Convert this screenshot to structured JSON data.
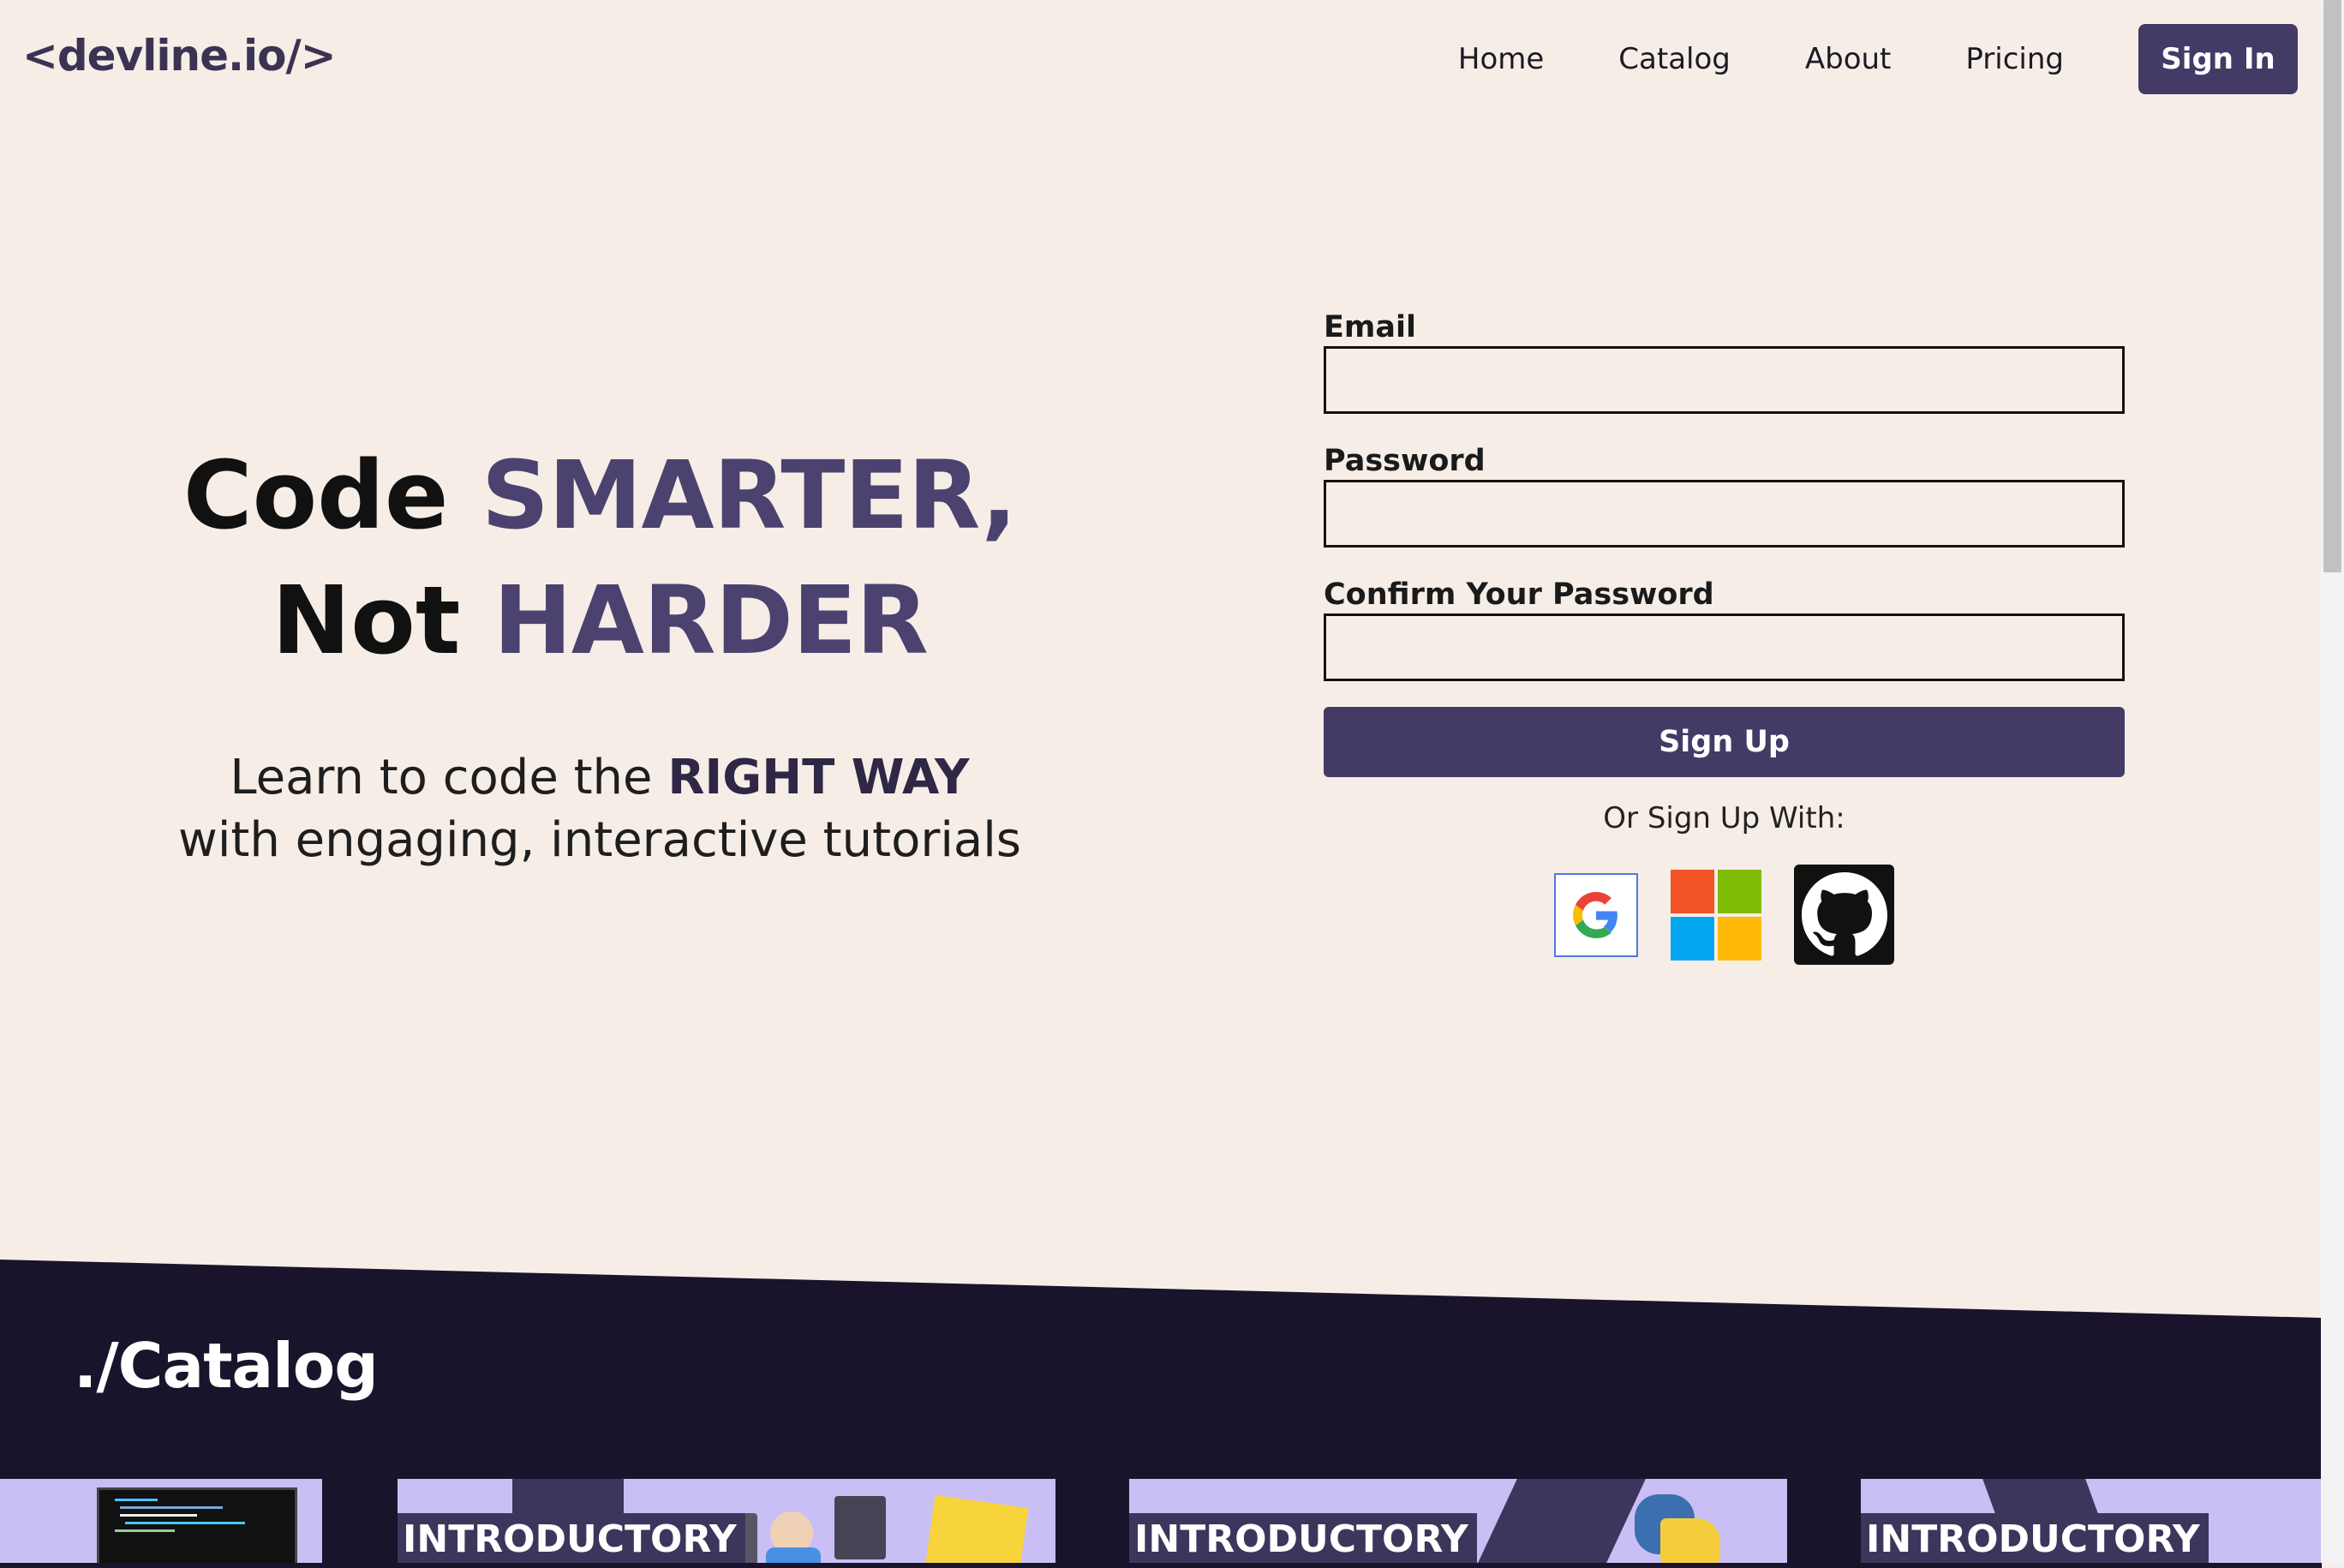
{
  "brand": {
    "logo": "<devline.io/>"
  },
  "nav": {
    "links": [
      "Home",
      "Catalog",
      "About",
      "Pricing"
    ],
    "signin": "Sign In"
  },
  "hero": {
    "line1_a": "Code",
    "line1_b": "SMARTER,",
    "line2_a": "Not",
    "line2_b": "HARDER",
    "sub_a": "Learn to code the",
    "sub_b": "RIGHT WAY",
    "sub_c": "with engaging, interactive tutorials"
  },
  "form": {
    "email_label": "Email",
    "email_value": "",
    "password_label": "Password",
    "password_value": "",
    "confirm_label": "Confirm Your Password",
    "confirm_value": "",
    "submit": "Sign Up",
    "or_text": "Or Sign Up With:",
    "providers": [
      "google-icon",
      "microsoft-icon",
      "github-icon"
    ]
  },
  "catalog": {
    "title": "./Catalog",
    "cards": [
      {
        "label": ""
      },
      {
        "label": "INTRODUCTORY"
      },
      {
        "label": "INTRODUCTORY"
      },
      {
        "label": "INTRODUCTORY"
      }
    ]
  },
  "colors": {
    "background": "#f6eee6",
    "accent": "#433a66",
    "catalog_bg": "#19142b",
    "card_bg": "#c9bff5"
  }
}
